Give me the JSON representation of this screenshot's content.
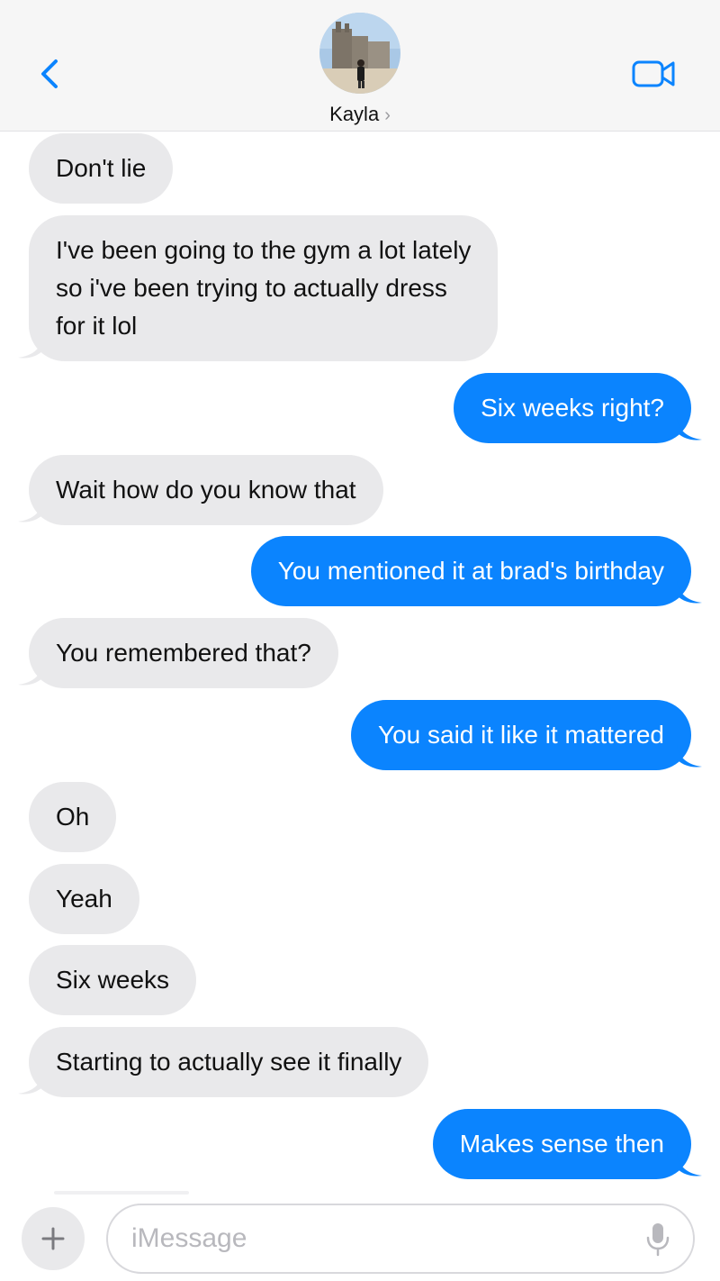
{
  "header": {
    "contact_name": "Kayla",
    "name_chevron": "›",
    "back_icon": "chevron-left-icon",
    "video_icon": "video-camera-icon",
    "accent": "#0b84fe"
  },
  "colors": {
    "incoming_bubble": "#e9e9eb",
    "outgoing_bubble": "#0b84fe",
    "header_bg": "#f6f6f6"
  },
  "messages": [
    {
      "direction": "incoming",
      "lines": [
        "Don't lie"
      ]
    },
    {
      "direction": "incoming",
      "lines": [
        "I've been going to the gym a lot lately",
        "so i've been trying to actually dress",
        "for it lol"
      ]
    },
    {
      "direction": "outgoing",
      "lines": [
        "Six weeks right?"
      ]
    },
    {
      "direction": "incoming",
      "lines": [
        "Wait how do you know that"
      ]
    },
    {
      "direction": "outgoing",
      "lines": [
        "You mentioned it at brad's birthday"
      ]
    },
    {
      "direction": "incoming",
      "lines": [
        "You remembered that?"
      ]
    },
    {
      "direction": "outgoing",
      "lines": [
        "You said it like it mattered"
      ]
    },
    {
      "direction": "incoming",
      "lines": [
        "Oh"
      ]
    },
    {
      "direction": "incoming",
      "lines": [
        "Yeah"
      ]
    },
    {
      "direction": "incoming",
      "lines": [
        "Six weeks"
      ]
    },
    {
      "direction": "incoming",
      "lines": [
        "Starting to actually see it finally"
      ]
    },
    {
      "direction": "outgoing",
      "lines": [
        "Makes sense then"
      ]
    }
  ],
  "composer": {
    "placeholder": "iMessage",
    "plus_icon": "plus-icon",
    "mic_icon": "microphone-icon"
  }
}
